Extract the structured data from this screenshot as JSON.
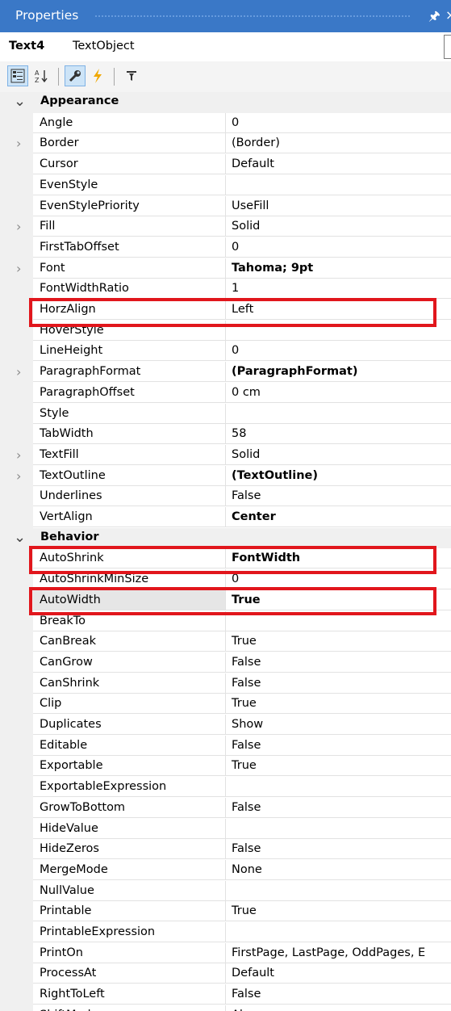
{
  "titlebar": {
    "title": "Properties",
    "pin_icon": "pin-icon",
    "close_icon": "close-icon"
  },
  "object": {
    "name": "Text4",
    "type": "TextObject"
  },
  "toolbar": {
    "buttons": [
      "categorized-icon",
      "alphabetical-icon",
      "properties-icon",
      "events-icon",
      "filter-icon"
    ],
    "active": [
      "categorized",
      "properties"
    ]
  },
  "accent_color": "#3a78c7",
  "highlight_color": "#e1161c",
  "categories": [
    {
      "label": "Appearance",
      "expanded": true
    },
    {
      "label": "Behavior",
      "expanded": true
    }
  ],
  "rows": [
    {
      "name": "Angle",
      "value": "0"
    },
    {
      "name": "Border",
      "value": "(Border)",
      "expandable": true
    },
    {
      "name": "Cursor",
      "value": "Default"
    },
    {
      "name": "EvenStyle",
      "value": ""
    },
    {
      "name": "EvenStylePriority",
      "value": "UseFill"
    },
    {
      "name": "Fill",
      "value": "Solid",
      "expandable": true
    },
    {
      "name": "FirstTabOffset",
      "value": "0"
    },
    {
      "name": "Font",
      "value": "Tahoma; 9pt",
      "expandable": true,
      "bold": true
    },
    {
      "name": "FontWidthRatio",
      "value": "1"
    },
    {
      "name": "HorzAlign",
      "value": "Left",
      "highlighted": true
    },
    {
      "name": "HoverStyle",
      "value": ""
    },
    {
      "name": "LineHeight",
      "value": "0"
    },
    {
      "name": "ParagraphFormat",
      "value": "(ParagraphFormat)",
      "expandable": true,
      "bold": true
    },
    {
      "name": "ParagraphOffset",
      "value": "0 cm"
    },
    {
      "name": "Style",
      "value": ""
    },
    {
      "name": "TabWidth",
      "value": "58"
    },
    {
      "name": "TextFill",
      "value": "Solid",
      "expandable": true
    },
    {
      "name": "TextOutline",
      "value": "(TextOutline)",
      "expandable": true,
      "bold": true
    },
    {
      "name": "Underlines",
      "value": "False"
    },
    {
      "name": "VertAlign",
      "value": "Center",
      "bold": true
    },
    {
      "name": "AutoShrink",
      "value": "FontWidth",
      "bold": true,
      "highlighted": true
    },
    {
      "name": "AutoShrinkMinSize",
      "value": "0"
    },
    {
      "name": "AutoWidth",
      "value": "True",
      "bold": true,
      "highlighted": true,
      "selected": true
    },
    {
      "name": "BreakTo",
      "value": ""
    },
    {
      "name": "CanBreak",
      "value": "True"
    },
    {
      "name": "CanGrow",
      "value": "False"
    },
    {
      "name": "CanShrink",
      "value": "False"
    },
    {
      "name": "Clip",
      "value": "True"
    },
    {
      "name": "Duplicates",
      "value": "Show"
    },
    {
      "name": "Editable",
      "value": "False"
    },
    {
      "name": "Exportable",
      "value": "True"
    },
    {
      "name": "ExportableExpression",
      "value": ""
    },
    {
      "name": "GrowToBottom",
      "value": "False"
    },
    {
      "name": "HideValue",
      "value": ""
    },
    {
      "name": "HideZeros",
      "value": "False"
    },
    {
      "name": "MergeMode",
      "value": "None"
    },
    {
      "name": "NullValue",
      "value": ""
    },
    {
      "name": "Printable",
      "value": "True"
    },
    {
      "name": "PrintableExpression",
      "value": ""
    },
    {
      "name": "PrintOn",
      "value": "FirstPage, LastPage, OddPages, E"
    },
    {
      "name": "ProcessAt",
      "value": "Default"
    },
    {
      "name": "RightToLeft",
      "value": "False"
    },
    {
      "name": "ShiftMode",
      "value": "Always"
    }
  ]
}
